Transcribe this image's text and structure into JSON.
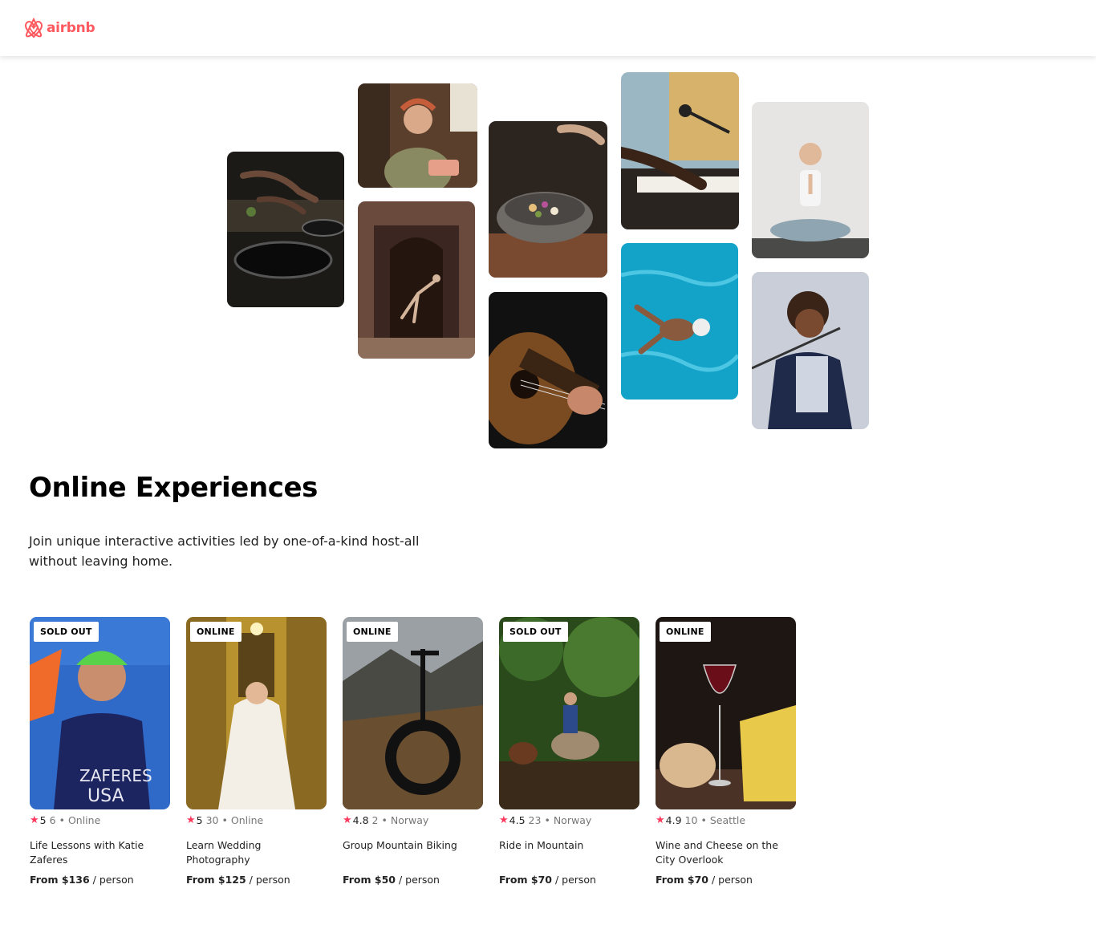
{
  "brand": {
    "name": "airbnb",
    "color": "#FF5A5F"
  },
  "hero": {
    "title": "Online Experiences",
    "subtitle": "Join unique interactive activities led by one-of-a-kind host-all without leaving home."
  },
  "colors": {
    "star": "#FE395D",
    "muted": "#777777"
  },
  "cards": [
    {
      "badge": "SOLD OUT",
      "rating": "5",
      "reviews": "6",
      "location": "Online",
      "title": "Life Lessons with Katie Zaferes",
      "price": "From $136",
      "unit": "/ person"
    },
    {
      "badge": "ONLINE",
      "rating": "5",
      "reviews": "30",
      "location": "Online",
      "title": "Learn Wedding Photography",
      "price": "From $125",
      "unit": "/ person"
    },
    {
      "badge": "ONLINE",
      "rating": "4.8",
      "reviews": "2",
      "location": "Norway",
      "title": "Group Mountain Biking",
      "price": "From $50",
      "unit": "/ person"
    },
    {
      "badge": "SOLD OUT",
      "rating": "4.5",
      "reviews": "23",
      "location": "Norway",
      "title": "Ride in Mountain",
      "price": "From $70",
      "unit": "/ person"
    },
    {
      "badge": "ONLINE",
      "rating": "4.9",
      "reviews": "10",
      "location": "Seattle",
      "title": "Wine and Cheese on the City Overlook",
      "price": "From $70",
      "unit": "/ person"
    }
  ]
}
